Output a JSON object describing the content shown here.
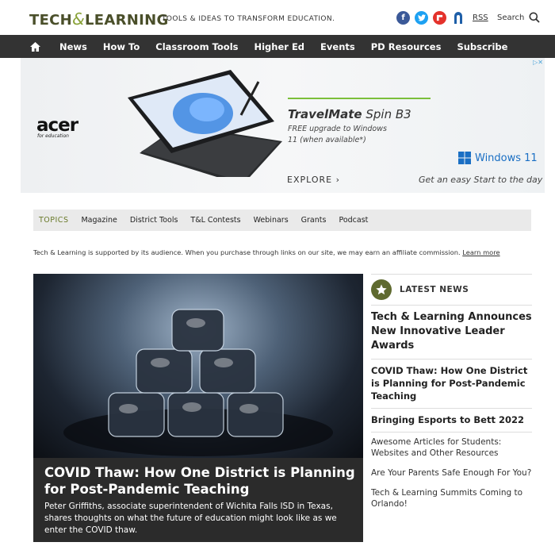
{
  "header": {
    "logo_left": "TECH",
    "logo_amp": "&",
    "logo_right": "LEARNING",
    "tagline": "TOOLS & IDEAS TO TRANSFORM EDUCATION.",
    "rss_label": "RSS",
    "search_label": "Search"
  },
  "nav": {
    "items": [
      "News",
      "How To",
      "Classroom Tools",
      "Higher Ed",
      "Events",
      "PD Resources",
      "Subscribe"
    ]
  },
  "ad": {
    "brand": "acer",
    "brand_sub": "for education",
    "title_bold": "TravelMate",
    "title_rest": " Spin B3",
    "sub": "FREE upgrade to Windows 11 (when available*)",
    "windows": "Windows 11",
    "explore": "EXPLORE ›",
    "tagline": "Get an easy Start to the day",
    "close": "▷✕"
  },
  "topics": {
    "label": "TOPICS",
    "items": [
      "Magazine",
      "District Tools",
      "T&L Contests",
      "Webinars",
      "Grants",
      "Podcast"
    ]
  },
  "disclaimer": {
    "text": "Tech & Learning is supported by its audience. When you purchase through links on our site, we may earn an affiliate commission. ",
    "link": "Learn more"
  },
  "hero": {
    "title": "COVID Thaw: How One District is Planning for Post-Pandemic Teaching",
    "description": "Peter Griffiths, associate superintendent of Wichita Falls ISD in Texas, shares thoughts on what the future of education might look like as we enter the COVID thaw."
  },
  "latest": {
    "heading": "LATEST NEWS",
    "items": [
      "Tech & Learning Announces New Innovative Leader Awards",
      "COVID Thaw: How One District is Planning for Post-Pandemic Teaching",
      "Bringing Esports to Bett 2022",
      "Awesome Articles for Students: Websites and Other Resources",
      "Are Your Parents Safe Enough For You?",
      "Tech & Learning Summits Coming to Orlando!"
    ]
  },
  "colors": {
    "nav_bg": "#333333",
    "logo_dark": "#4a4f2a",
    "logo_accent": "#8aa33a",
    "badge": "#5f6a2f"
  }
}
